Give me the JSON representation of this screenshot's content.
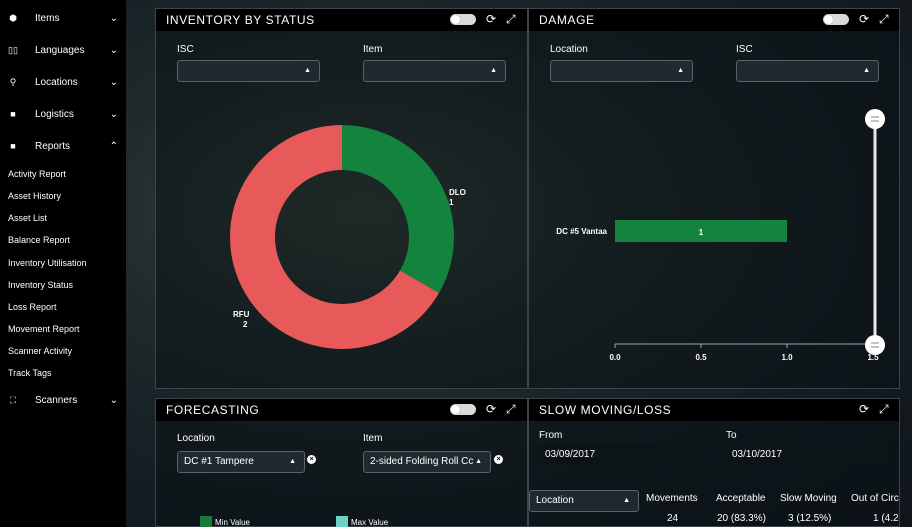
{
  "sidebar": {
    "items": [
      {
        "label": "Items",
        "icon": "cube-icon"
      },
      {
        "label": "Languages",
        "icon": "book-icon"
      },
      {
        "label": "Locations",
        "icon": "map-marker-icon"
      },
      {
        "label": "Logistics",
        "icon": "truck-icon"
      },
      {
        "label": "Reports",
        "icon": "report-icon"
      }
    ],
    "reports": [
      "Activity Report",
      "Asset History",
      "Asset List",
      "Balance Report",
      "Inventory Utilisation",
      "Inventory Status",
      "Loss Report",
      "Movement Report",
      "Scanner Activity",
      "Track Tags"
    ],
    "scanners": {
      "label": "Scanners",
      "icon": "scanner-icon"
    }
  },
  "inventory": {
    "title": "INVENTORY BY STATUS",
    "isc_label": "ISC",
    "item_label": "Item",
    "isc_value": "",
    "item_value": ""
  },
  "damage": {
    "title": "DAMAGE",
    "location_label": "Location",
    "isc_label": "ISC",
    "location_value": "",
    "isc_value": ""
  },
  "forecasting": {
    "title": "FORECASTING",
    "location_label": "Location",
    "item_label": "Item",
    "location_value": "DC #1 Tampere",
    "item_value": "2-sided Folding Roll Cc",
    "legend_min": "Min Value",
    "legend_max": "Max Value",
    "colors": {
      "min": "#1a7a3a",
      "max": "#6ecfc4"
    }
  },
  "slow": {
    "title": "SLOW MOVING/LOSS",
    "from_label": "From",
    "to_label": "To",
    "from_value": "03/09/2017",
    "to_value": "03/10/2017",
    "location_select": "Location",
    "columns": [
      "Movements",
      "Acceptable",
      "Slow Moving",
      "Out of Circ"
    ],
    "row": [
      "24",
      "20 (83.3%)",
      "3 (12.5%)",
      "1 (4.2"
    ]
  },
  "chart_data": [
    {
      "type": "pie",
      "title": "INVENTORY BY STATUS",
      "categories": [
        "DLO",
        "RFU"
      ],
      "values": [
        1,
        2
      ],
      "colors": [
        "#13833e",
        "#e85a5a"
      ],
      "donut": true
    },
    {
      "type": "bar",
      "orientation": "horizontal",
      "title": "DAMAGE",
      "categories": [
        "DC #5 Vantaa"
      ],
      "values": [
        1
      ],
      "xlim": [
        0,
        1.5
      ],
      "xticks": [
        "0.0",
        "0.5",
        "1.0",
        "1.5"
      ],
      "colors": [
        "#13833e"
      ]
    }
  ]
}
